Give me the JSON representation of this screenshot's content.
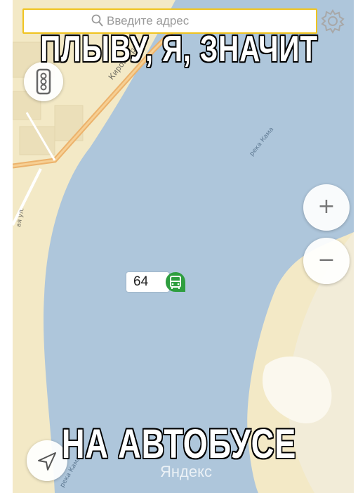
{
  "search": {
    "placeholder": "Введите адрес"
  },
  "map": {
    "street_label": "Кировогр",
    "street_label_side": "ая ул.",
    "river_label_top": "река Кама",
    "river_label_bottom": "река Кама",
    "logo_text": "Яндекс",
    "colors": {
      "land": "#f3e9c6",
      "water": "#aec6db",
      "road": "#ecb26b",
      "accent": "#f0c420",
      "transit": "#2e9e3f"
    }
  },
  "transit_stop": {
    "route_number": "64",
    "icon": "bus-icon"
  },
  "controls": {
    "zoom_in": "+",
    "zoom_out": "−",
    "settings_icon": "gear-icon",
    "traffic_icon": "traffic-light-icon",
    "locate_icon": "navigation-arrow-icon"
  },
  "captions": {
    "top": "ПЛЫВУ, Я, ЗНАЧИТ",
    "bottom": "НА АВТОБУСЕ"
  }
}
